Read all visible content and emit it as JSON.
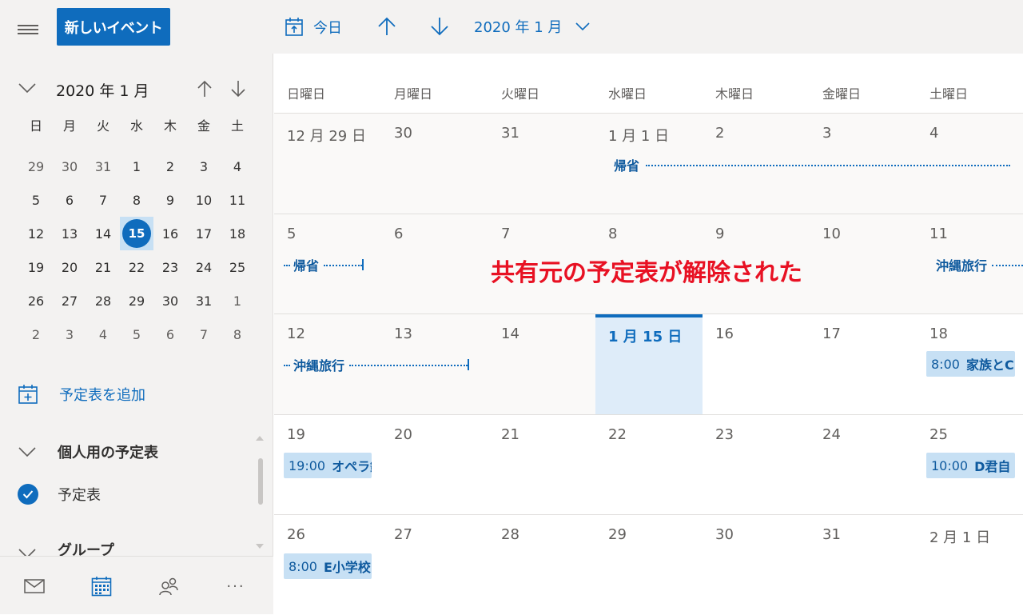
{
  "topbar": {
    "new_event_label": "新しいイベント",
    "today_label": "今日",
    "current_month": "2020 年 1 月"
  },
  "mini_calendar": {
    "title": "2020 年 1 月",
    "weekdays": [
      "日",
      "月",
      "火",
      "水",
      "木",
      "金",
      "土"
    ],
    "weeks": [
      [
        "29",
        "30",
        "31",
        "1",
        "2",
        "3",
        "4"
      ],
      [
        "5",
        "6",
        "7",
        "8",
        "9",
        "10",
        "11"
      ],
      [
        "12",
        "13",
        "14",
        "15",
        "16",
        "17",
        "18"
      ],
      [
        "19",
        "20",
        "21",
        "22",
        "23",
        "24",
        "25"
      ],
      [
        "26",
        "27",
        "28",
        "29",
        "30",
        "31",
        "1"
      ],
      [
        "2",
        "3",
        "4",
        "5",
        "6",
        "7",
        "8"
      ]
    ],
    "today": "15"
  },
  "sidebar": {
    "add_calendar_label": "予定表を追加",
    "personal_group_label": "個人用の予定表",
    "calendar_item_label": "予定表",
    "group_label": "グループ"
  },
  "bottom_nav": {
    "more_label": "···"
  },
  "calendar": {
    "weekday_headers": [
      "日曜日",
      "月曜日",
      "火曜日",
      "水曜日",
      "木曜日",
      "金曜日",
      "土曜日"
    ],
    "weeks": [
      [
        "12 月 29 日",
        "30",
        "31",
        "1 月 1 日",
        "2",
        "3",
        "4"
      ],
      [
        "5",
        "6",
        "7",
        "8",
        "9",
        "10",
        "11"
      ],
      [
        "12",
        "13",
        "14",
        "1 月 15 日",
        "16",
        "17",
        "18"
      ],
      [
        "19",
        "20",
        "21",
        "22",
        "23",
        "24",
        "25"
      ],
      [
        "26",
        "27",
        "28",
        "29",
        "30",
        "31",
        "2 月 1 日"
      ]
    ],
    "events": {
      "kisei_1": "帰省",
      "kisei_2": "帰省",
      "okinawa_1": "沖縄旅行",
      "okinawa_2": "沖縄旅行",
      "family": {
        "time": "8:00",
        "title": "家族とC"
      },
      "opera": {
        "time": "19:00",
        "title": "オペラ鑑"
      },
      "d_kun": {
        "time": "10:00",
        "title": "D君自"
      },
      "e_school": {
        "time": "8:00",
        "title": "E小学校"
      }
    },
    "accent_color": "#0f6cbd",
    "today_bg": "#deecf9"
  },
  "annotation": {
    "text": "共有元の予定表が解除された",
    "color": "#e81123"
  }
}
